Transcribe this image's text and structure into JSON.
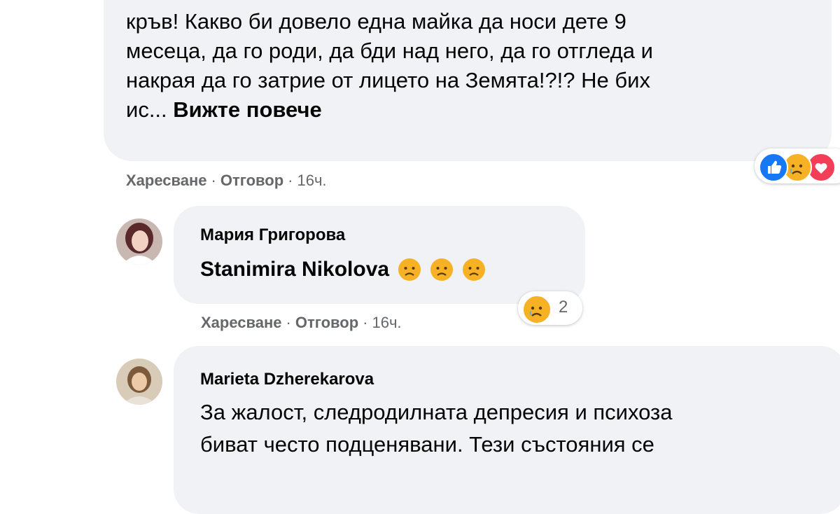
{
  "comment1": {
    "text": "кръв! Какво би довело една майка да носи дете 9\nмесеца, да го роди, да бди над него, да го отгледа и\nнакрая да го затрие от лицето на Земята!?!? Не бих\nис... ",
    "see_more": "Вижте повече",
    "actions": {
      "like": "Харесване",
      "reply": "Отговор",
      "time": "16ч."
    },
    "reactions": [
      "like-icon",
      "sad-icon",
      "love-icon"
    ]
  },
  "comment2": {
    "author": "Мария Григорова",
    "mention": "Stanimira Nikolova",
    "emoji": [
      "sad-face",
      "sad-face",
      "sad-face"
    ],
    "reaction_count": "2",
    "actions": {
      "like": "Харесване",
      "reply": "Отговор",
      "time": "16ч."
    }
  },
  "comment3": {
    "author": "Marieta Dzherekarova",
    "text": "За жалост, следродилната депресия и психоза\nбиват често подценявани. Тези състояния се"
  },
  "colors": {
    "bubble": "#f0f2f5",
    "meta_text": "#65676b",
    "like_blue": "#1877f2",
    "sad_yellow": "#f7b125",
    "love_red": "#f33e58"
  }
}
